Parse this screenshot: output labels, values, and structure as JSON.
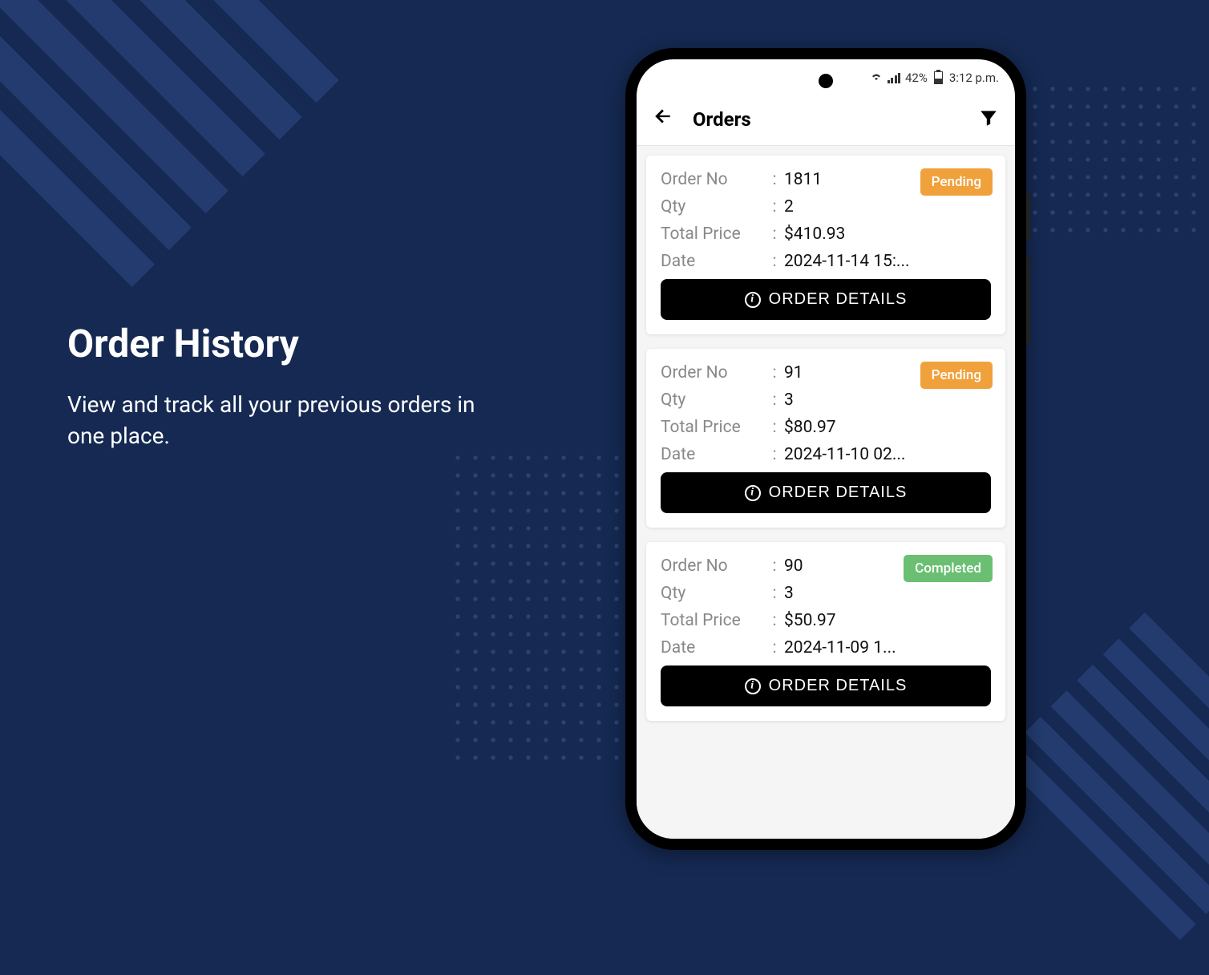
{
  "hero": {
    "title": "Order History",
    "subtitle": "View and track all your previous orders in one place."
  },
  "statusbar": {
    "battery": "42%",
    "time": "3:12 p.m."
  },
  "appbar": {
    "title": "Orders"
  },
  "labels": {
    "order_no": "Order No",
    "qty": "Qty",
    "total_price": "Total Price",
    "date": "Date",
    "details_button": "ORDER DETAILS",
    "colon": ":"
  },
  "status_text": {
    "pending": "Pending",
    "completed": "Completed"
  },
  "orders": [
    {
      "order_no": "1811",
      "qty": "2",
      "total_price": "$410.93",
      "date": "2024-11-14 15:...",
      "status": "pending"
    },
    {
      "order_no": "91",
      "qty": "3",
      "total_price": "$80.97",
      "date": "2024-11-10 02...",
      "status": "pending"
    },
    {
      "order_no": "90",
      "qty": "3",
      "total_price": "$50.97",
      "date": "2024-11-09 1...",
      "status": "completed"
    }
  ],
  "colors": {
    "pending": "#f0a13b",
    "completed": "#6bbf73"
  }
}
